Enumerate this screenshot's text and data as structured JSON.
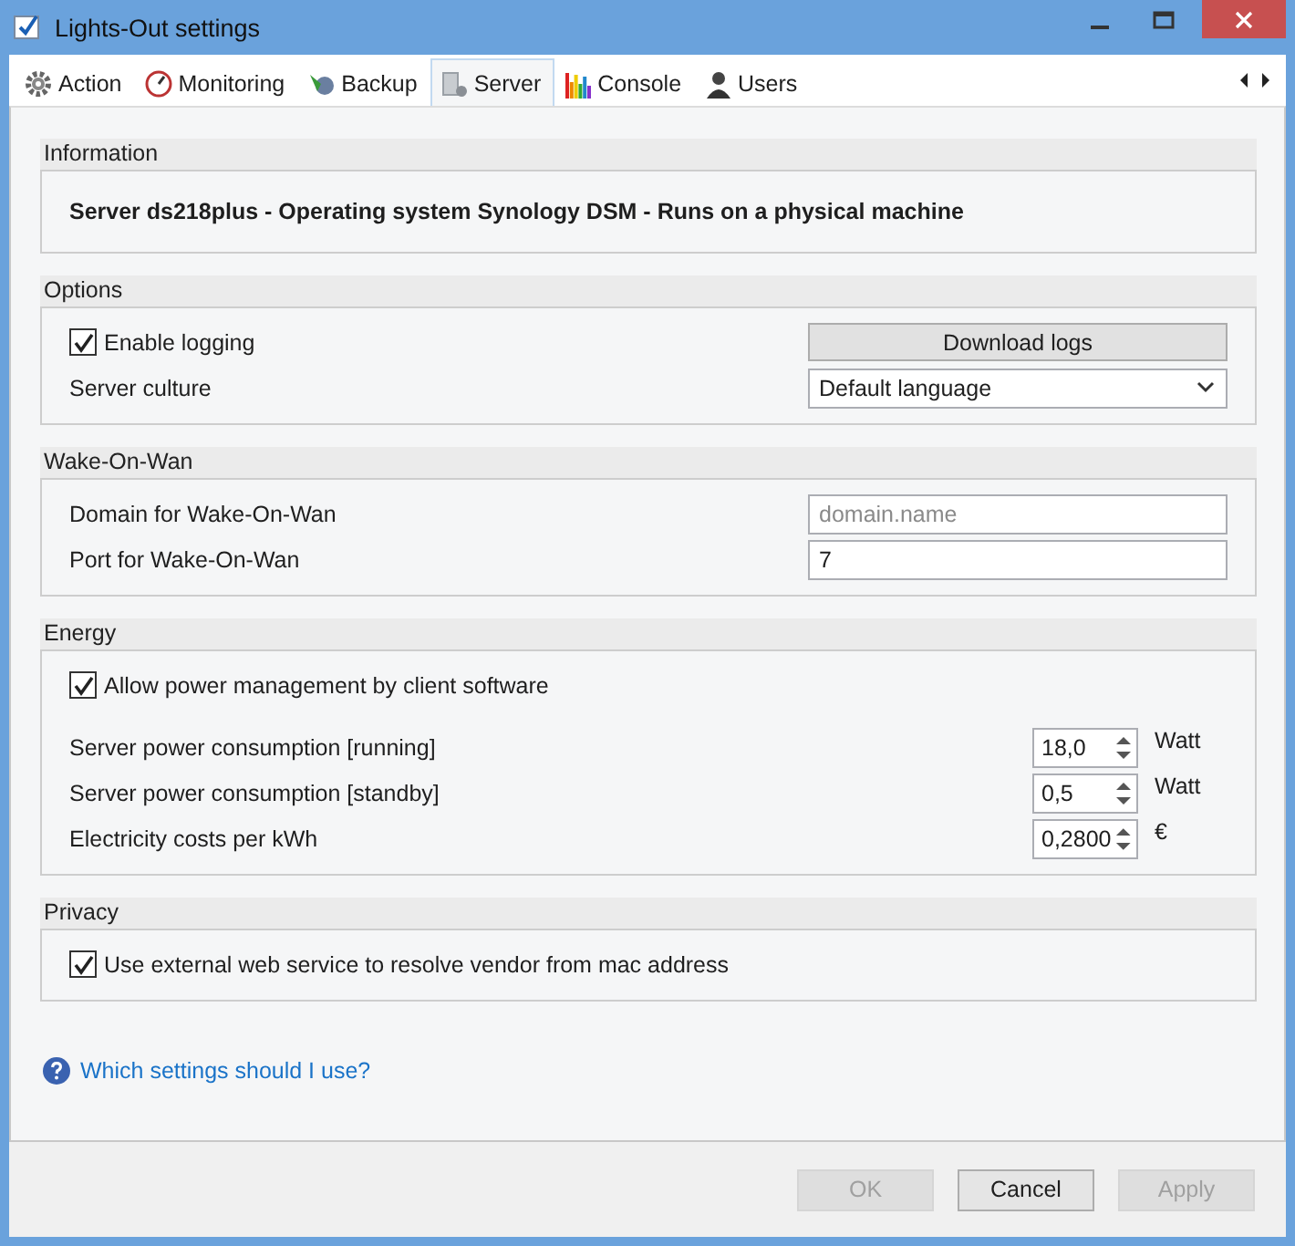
{
  "window": {
    "title": "Lights-Out settings"
  },
  "tabs": [
    {
      "label": "Action",
      "selected": false
    },
    {
      "label": "Monitoring",
      "selected": false
    },
    {
      "label": "Backup",
      "selected": false
    },
    {
      "label": "Server",
      "selected": true
    },
    {
      "label": "Console",
      "selected": false
    },
    {
      "label": "Users",
      "selected": false
    }
  ],
  "sections": [
    {
      "title": "Information",
      "rows": [
        {
          "kind": "info",
          "text": "Server ds218plus - Operating system Synology DSM - Runs on a physical machine"
        }
      ]
    },
    {
      "title": "Options",
      "rows": [
        {
          "kind": "checkbox",
          "label": "Enable logging",
          "checked": true,
          "button": "Download logs"
        },
        {
          "kind": "select",
          "label": "Server culture",
          "value": "Default language"
        }
      ]
    },
    {
      "title": "Wake-On-Wan",
      "rows": [
        {
          "kind": "field",
          "label": "Domain for Wake-On-Wan",
          "placeholder": "domain.name"
        },
        {
          "kind": "field",
          "label": "Port for Wake-On-Wan",
          "value": "7"
        }
      ]
    },
    {
      "title": "Energy",
      "rows": [
        {
          "kind": "checkbox",
          "label": "Allow power management by client software",
          "checked": true
        },
        {
          "kind": "spinner",
          "label": "Server power consumption [running]",
          "value": "18,0",
          "unit": "Watt"
        },
        {
          "kind": "spinner",
          "label": "Server power consumption [standby]",
          "value": "0,5",
          "unit": "Watt"
        },
        {
          "kind": "spinner",
          "label": "Electricity costs per kWh",
          "value": "0,2800",
          "unit": "€"
        }
      ]
    },
    {
      "title": "Privacy",
      "rows": [
        {
          "kind": "checkbox",
          "label": "Use external web service to resolve vendor from mac address",
          "checked": true
        }
      ]
    }
  ],
  "help_link": "Which settings should I use?",
  "buttons": [
    {
      "label": "OK",
      "disabled": true
    },
    {
      "label": "Cancel",
      "disabled": false
    },
    {
      "label": "Apply",
      "disabled": true
    }
  ]
}
